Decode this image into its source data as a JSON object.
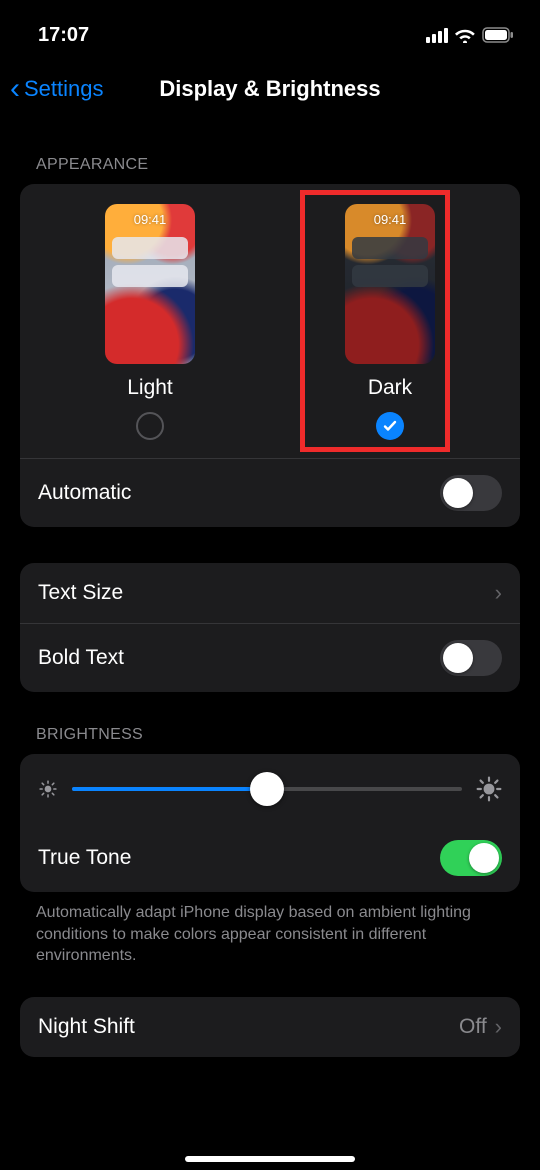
{
  "status": {
    "time": "17:07"
  },
  "nav": {
    "back_label": "Settings",
    "title": "Display & Brightness"
  },
  "appearance": {
    "header": "Appearance",
    "preview_time": "09:41",
    "light_label": "Light",
    "dark_label": "Dark",
    "selected": "dark",
    "automatic_label": "Automatic",
    "automatic_on": false
  },
  "text": {
    "size_label": "Text Size",
    "bold_label": "Bold Text",
    "bold_on": false
  },
  "brightness": {
    "header": "Brightness",
    "value_pct": 50,
    "truetone_label": "True Tone",
    "truetone_on": true,
    "truetone_note": "Automatically adapt iPhone display based on ambient lighting conditions to make colors appear consistent in different environments."
  },
  "nightshift": {
    "label": "Night Shift",
    "value": "Off"
  }
}
